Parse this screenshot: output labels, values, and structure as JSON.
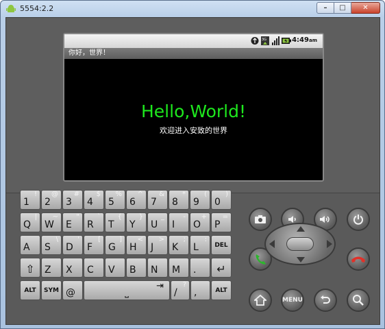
{
  "window": {
    "title": "5554:2.2",
    "min_label": "–",
    "max_label": "□",
    "close_label": "✕"
  },
  "status": {
    "time": "4:49",
    "time_suffix": "am"
  },
  "app": {
    "title": "你好，世界！",
    "hello": "Hello,World!",
    "welcome": "欢迎进入安致的世界"
  },
  "keyboard": {
    "row1": [
      {
        "main": "1",
        "alt": "!"
      },
      {
        "main": "2",
        "alt": "@"
      },
      {
        "main": "3",
        "alt": "#"
      },
      {
        "main": "4",
        "alt": "$"
      },
      {
        "main": "5",
        "alt": "%"
      },
      {
        "main": "6",
        "alt": "^"
      },
      {
        "main": "7",
        "alt": "&"
      },
      {
        "main": "8",
        "alt": "*"
      },
      {
        "main": "9",
        "alt": "("
      },
      {
        "main": "0",
        "alt": ")"
      }
    ],
    "row2": [
      {
        "main": "Q",
        "alt": "|"
      },
      {
        "main": "W",
        "alt": "~"
      },
      {
        "main": "E",
        "alt": "\""
      },
      {
        "main": "R",
        "alt": "`"
      },
      {
        "main": "T",
        "alt": "{"
      },
      {
        "main": "Y",
        "alt": "}"
      },
      {
        "main": "U",
        "alt": "_"
      },
      {
        "main": "I",
        "alt": "-"
      },
      {
        "main": "O",
        "alt": "+"
      },
      {
        "main": "P",
        "alt": "="
      }
    ],
    "row3": [
      {
        "main": "A",
        "alt": ""
      },
      {
        "main": "S",
        "alt": "\\"
      },
      {
        "main": "D",
        "alt": "'"
      },
      {
        "main": "F",
        "alt": "["
      },
      {
        "main": "G",
        "alt": "]"
      },
      {
        "main": "H",
        "alt": "<"
      },
      {
        "main": "J",
        "alt": ">"
      },
      {
        "main": "K",
        "alt": ";"
      },
      {
        "main": "L",
        "alt": ":"
      },
      {
        "main": "DEL",
        "alt": ""
      }
    ],
    "row4": [
      {
        "main": "⇧",
        "alt": ""
      },
      {
        "main": "Z",
        "alt": ""
      },
      {
        "main": "X",
        "alt": ""
      },
      {
        "main": "C",
        "alt": ""
      },
      {
        "main": "V",
        "alt": ""
      },
      {
        "main": "B",
        "alt": ""
      },
      {
        "main": "N",
        "alt": ""
      },
      {
        "main": "M",
        "alt": ""
      },
      {
        "main": ".",
        "alt": ""
      },
      {
        "main": "↵",
        "alt": ""
      }
    ],
    "row5": {
      "alt_left": "ALT",
      "sym": "SYM",
      "at": "@",
      "space": "⎵",
      "tab": "⇥",
      "slash": "/",
      "slash_alt": "?",
      "comma": ",",
      "alt_right": "ALT"
    }
  },
  "controls": {
    "menu_label": "MENU"
  }
}
